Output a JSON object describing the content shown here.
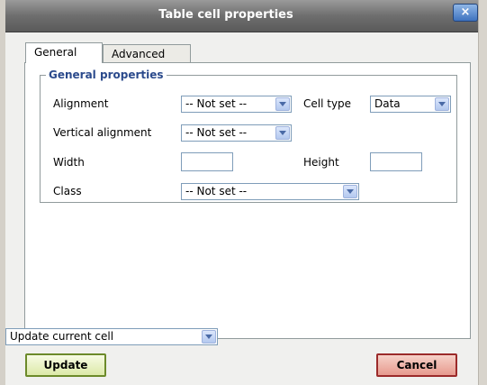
{
  "window": {
    "title": "Table cell properties",
    "close_label": "×"
  },
  "tabs": [
    {
      "label": "General",
      "active": true
    },
    {
      "label": "Advanced",
      "active": false
    }
  ],
  "general": {
    "legend": "General properties",
    "alignment": {
      "label": "Alignment",
      "value": "-- Not set --"
    },
    "cell_type": {
      "label": "Cell type",
      "value": "Data"
    },
    "vertical_alignment": {
      "label": "Vertical alignment",
      "value": "-- Not set --"
    },
    "width": {
      "label": "Width",
      "value": ""
    },
    "height": {
      "label": "Height",
      "value": ""
    },
    "class": {
      "label": "Class",
      "value": "-- Not set --"
    }
  },
  "footer": {
    "scope_select": "Update current cell",
    "update_label": "Update",
    "cancel_label": "Cancel"
  },
  "colors": {
    "legend_text": "#2b4a8c",
    "update_border": "#6c8a2a",
    "cancel_border": "#9b2a2a"
  }
}
